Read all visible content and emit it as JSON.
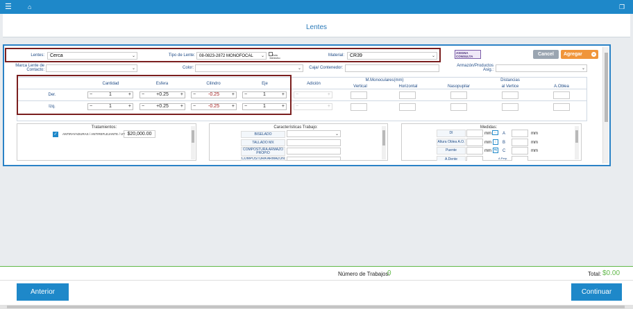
{
  "topbar": {
    "menu_icon": "hamburger-icon",
    "home_icon": "home-icon",
    "window_icon": "restore-icon"
  },
  "header": {
    "title": "Lentes"
  },
  "form": {
    "lentes_label": "Lentes:",
    "lentes_value": "Cerca",
    "tipo_label": "Tipo de Lente:",
    "tipo_value": "08-0823-2872 MONOFOCAL",
    "solo_derecho": "Solo Derecho",
    "material_label": "Material:",
    "material_value": "CR39",
    "asigna_consulta": "ASIGNA CONSULTA",
    "cancel": "Cancel",
    "agregar": "Agregar",
    "marca_label": "Marca Lente de Contacto:",
    "color_label": "Color:",
    "caja_label": "Caja/ Contenedor:",
    "armazon_label": "Armazón/Productos Asig.:"
  },
  "grid": {
    "headers": {
      "cantidad": "Cantidad",
      "esfera": "Esfera",
      "cilindro": "Cilindro",
      "eje": "Eje",
      "adicion": "Adición",
      "monoculares": "M.Monoculares(mm)",
      "vertical": "Vertical",
      "horizontal": "Horizontal",
      "distancias": "Distancias",
      "nasopupilar": "Nasopupilar",
      "alvertice": "al Vertice",
      "aoblea": "A.Oblea"
    },
    "rows": [
      {
        "label": "Der.",
        "cantidad": "1",
        "esfera": "+0.25",
        "cilindro": "-0.25",
        "eje": "1"
      },
      {
        "label": "Izq.",
        "cantidad": "1",
        "esfera": "+0.25",
        "cilindro": "-0.25",
        "eje": "1"
      }
    ]
  },
  "tratamientos": {
    "title": "Tratamientos:",
    "item": "ANTIRAYADURAS / ANTIREFLEJANTE / UV",
    "price": "$20,000.00"
  },
  "caracteristicas": {
    "title": "Características Trabajo:",
    "items": [
      "BISELADO",
      "TALLADO MX",
      "COMPOSTURA ARMAZO PROPIO",
      "COMPOSTURA ARMAZON"
    ]
  },
  "medidas": {
    "title": "Medidas:",
    "di": "DI",
    "altura": "Altura Oblea A.O.",
    "puente": "Puente",
    "a_dente": "A.Dente",
    "mm": "mm",
    "a": "A",
    "b": "B",
    "c": "C",
    "a_perp": "A.Perp."
  },
  "footer": {
    "trabajos_label": "Número de Trabajos:",
    "trabajos_value": "0",
    "total_label": "Total:",
    "total_value": "$0.00",
    "anterior": "Anterior",
    "continuar": "Continuar"
  },
  "colors": {
    "accent": "#1e88c9",
    "green": "#5fb847",
    "highlight": "#7a1e1e"
  }
}
